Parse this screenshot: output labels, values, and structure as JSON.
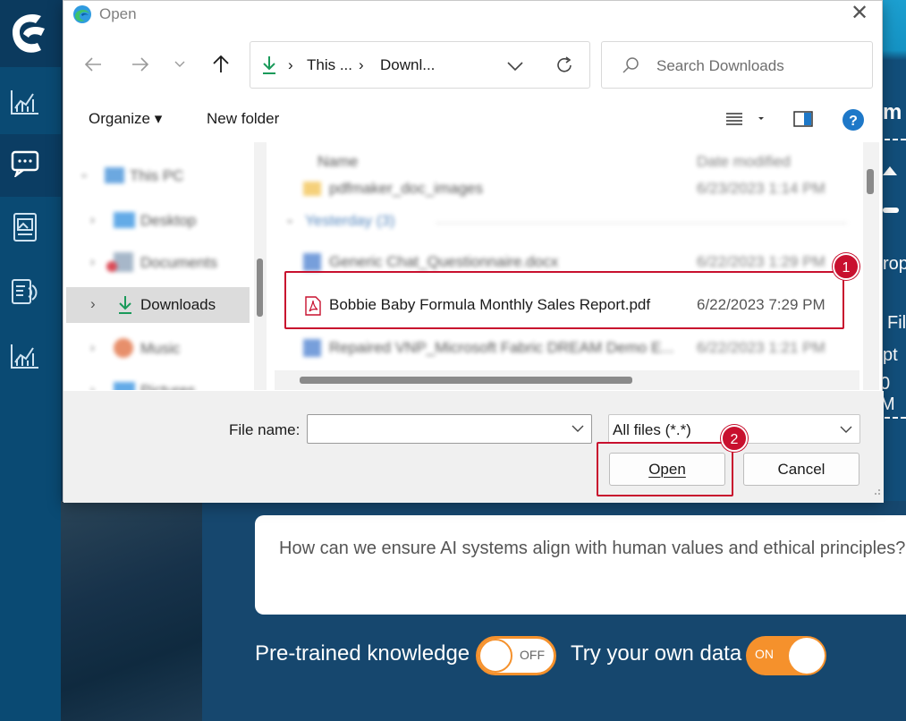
{
  "dialog": {
    "title": "Open",
    "close_glyph": "✕",
    "address": {
      "segments": [
        "This ...",
        "Downl..."
      ]
    },
    "search_placeholder": "Search Downloads",
    "commands": {
      "organize": "Organize",
      "new_folder": "New folder"
    },
    "tree": [
      {
        "label": "This PC"
      },
      {
        "label": "Desktop"
      },
      {
        "label": "Documents"
      },
      {
        "label": "Downloads"
      },
      {
        "label": "Music"
      },
      {
        "label": "Pictures"
      }
    ],
    "columns": {
      "name": "Name",
      "date": "Date modified"
    },
    "group_header": "Yesterday (3)",
    "files": [
      {
        "name": "pdfmaker_doc_images",
        "date": "6/23/2023 1:14 PM"
      },
      {
        "name": "Generic Chat_Questionnaire.docx",
        "date": "6/22/2023 1:29 PM"
      },
      {
        "name": "Bobbie Baby Formula Monthly Sales Report.pdf",
        "date": "6/22/2023 7:29 PM"
      },
      {
        "name": "Repaired VNP_Microsoft Fabric DREAM Demo E...",
        "date": "6/22/2023 1:21 PM"
      }
    ],
    "file_name_label": "File name:",
    "file_name_value": "",
    "filter": "All files (*.*)",
    "open_button": "Open",
    "cancel_button": "Cancel",
    "callouts": [
      "1",
      "2"
    ]
  },
  "app": {
    "prompt_text": "How can we ensure AI systems align with human values and ethical principles?",
    "pretrained_label": "Pre-trained knowledge",
    "pretrained_state": "OFF",
    "own_data_label": "Try your own data",
    "own_data_state": "ON",
    "right_fragments": [
      "m",
      "rop",
      "Fil",
      "pt",
      "0 M"
    ],
    "accent_color": "#f5912c"
  }
}
